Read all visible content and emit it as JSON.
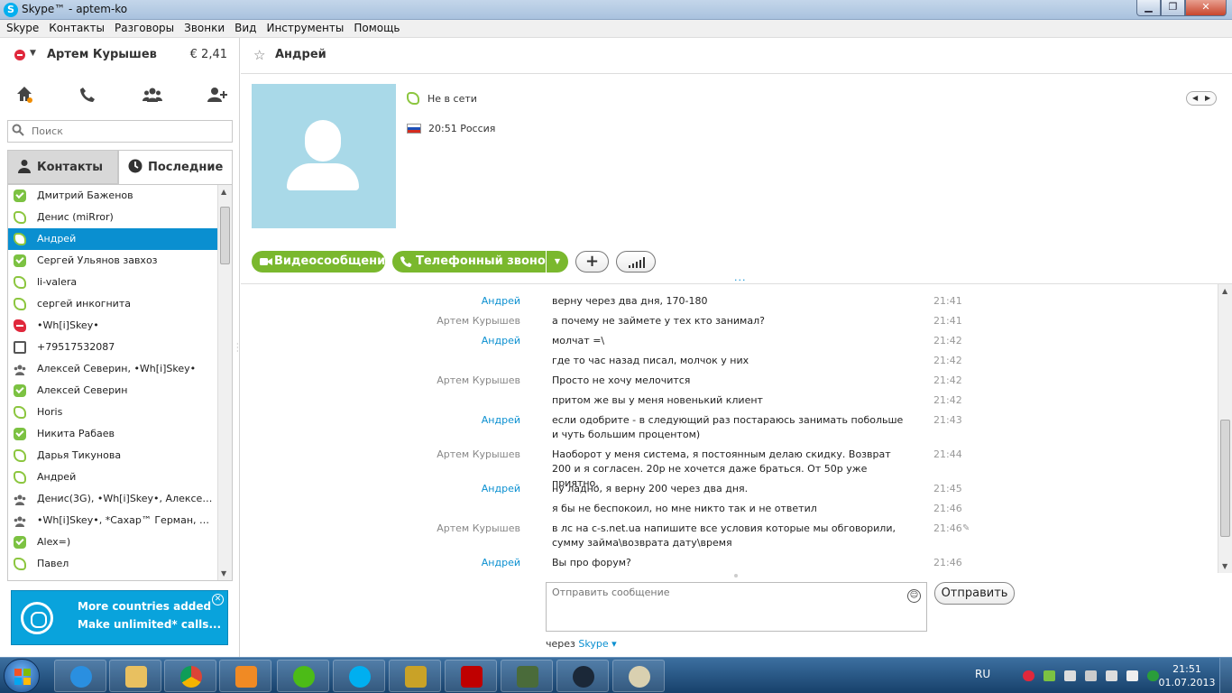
{
  "window": {
    "title": "Skype™ - aptem-ko"
  },
  "menu": [
    "Skype",
    "Контакты",
    "Разговоры",
    "Звонки",
    "Вид",
    "Инструменты",
    "Помощь"
  ],
  "profile": {
    "name": "Артем Курышев",
    "balance": "€ 2,41"
  },
  "search": {
    "placeholder": "Поиск"
  },
  "tabs": {
    "contacts": "Контакты",
    "recent": "Последние"
  },
  "contacts": [
    {
      "name": "Дмитрий Баженов",
      "status": "online"
    },
    {
      "name": "Денис (miRror)",
      "status": "offline"
    },
    {
      "name": "Андрей",
      "status": "offline",
      "selected": true
    },
    {
      "name": "Сергей Ульянов завхоз",
      "status": "online"
    },
    {
      "name": "li-valera",
      "status": "offline"
    },
    {
      "name": "сергей инкогнита",
      "status": "offline"
    },
    {
      "name": "•Wh[i]Skey•",
      "status": "dnd"
    },
    {
      "name": "+79517532087",
      "status": "phone"
    },
    {
      "name": "Алексей Северин, •Wh[i]Skey•",
      "status": "group"
    },
    {
      "name": "Алексей Северин",
      "status": "online"
    },
    {
      "name": "Horis",
      "status": "offline"
    },
    {
      "name": "Никита Рабаев",
      "status": "online"
    },
    {
      "name": "Дарья Тикунова",
      "status": "offline"
    },
    {
      "name": "Андрей",
      "status": "offline"
    },
    {
      "name": "Денис(3G), •Wh[i]Skey•, Алексей Се...",
      "status": "group"
    },
    {
      "name": "•Wh[i]Skey•, *Сахар™ Герман, Алек...",
      "status": "group"
    },
    {
      "name": "Alex=)",
      "status": "online"
    },
    {
      "name": "Павел",
      "status": "offline"
    }
  ],
  "ad": {
    "line1": "More countries added",
    "line2": "Make unlimited* calls..."
  },
  "conversation": {
    "name": "Андрей",
    "status_text": "Не в сети",
    "local_time": "20:51 Россия",
    "video_btn": "Видеосообщение",
    "call_btn": "Телефонный звонок",
    "plus": "+",
    "messages": [
      {
        "author": "Андрей",
        "self": false,
        "text": "верну через два дня, 170-180",
        "time": "21:41"
      },
      {
        "author": "Артем Курышев",
        "self": true,
        "text": "а почему не займете у тех кто занимал?",
        "time": "21:41"
      },
      {
        "author": "Андрей",
        "self": false,
        "text": "молчат =\\",
        "time": "21:42"
      },
      {
        "author": "",
        "self": false,
        "text": "где то час назад писал, молчок у них",
        "time": "21:42"
      },
      {
        "author": "Артем Курышев",
        "self": true,
        "text": "Просто не хочу мелочится",
        "time": "21:42"
      },
      {
        "author": "",
        "self": true,
        "text": "притом же вы у меня новенький клиент",
        "time": "21:42"
      },
      {
        "author": "Андрей",
        "self": false,
        "text": "если одобрите - в следующий раз постараюсь занимать побольше и чуть большим процентом)",
        "time": "21:43"
      },
      {
        "author": "Артем Курышев",
        "self": true,
        "text": "Наоборот у меня система, я постоянным делаю скидку. Возврат 200 и я согласен. 20р не хочется даже браться. От 50р уже приятно.",
        "time": "21:44"
      },
      {
        "author": "Андрей",
        "self": false,
        "text": "ну ладно, я верну 200 через два дня.",
        "time": "21:45"
      },
      {
        "author": "",
        "self": false,
        "text": "я бы не беспокоил, но мне никто так и не ответил",
        "time": "21:46"
      },
      {
        "author": "Артем Курышев",
        "self": true,
        "text": "в лс на c-s.net.ua напишите все условия которые мы обговорили, сумму займа\\возврата дату\\время",
        "time": "21:46",
        "edited": true
      },
      {
        "author": "Андрей",
        "self": false,
        "text": "Вы про форум?",
        "time": "21:46"
      }
    ],
    "compose_placeholder": "Отправить сообщение",
    "send_btn": "Отправить",
    "via_label": "через",
    "via_link": "Skype"
  },
  "taskbar": {
    "lang": "RU",
    "time": "21:51",
    "date": "01.07.2013",
    "apps": [
      "internet-explorer",
      "file-explorer",
      "chrome",
      "media-player",
      "icq",
      "skype",
      "game-app",
      "filezilla",
      "system-monitor",
      "steam",
      "paint"
    ]
  },
  "colors": {
    "accent": "#0a8fd0",
    "green": "#7ab82e",
    "selected": "#0a8fd0"
  }
}
